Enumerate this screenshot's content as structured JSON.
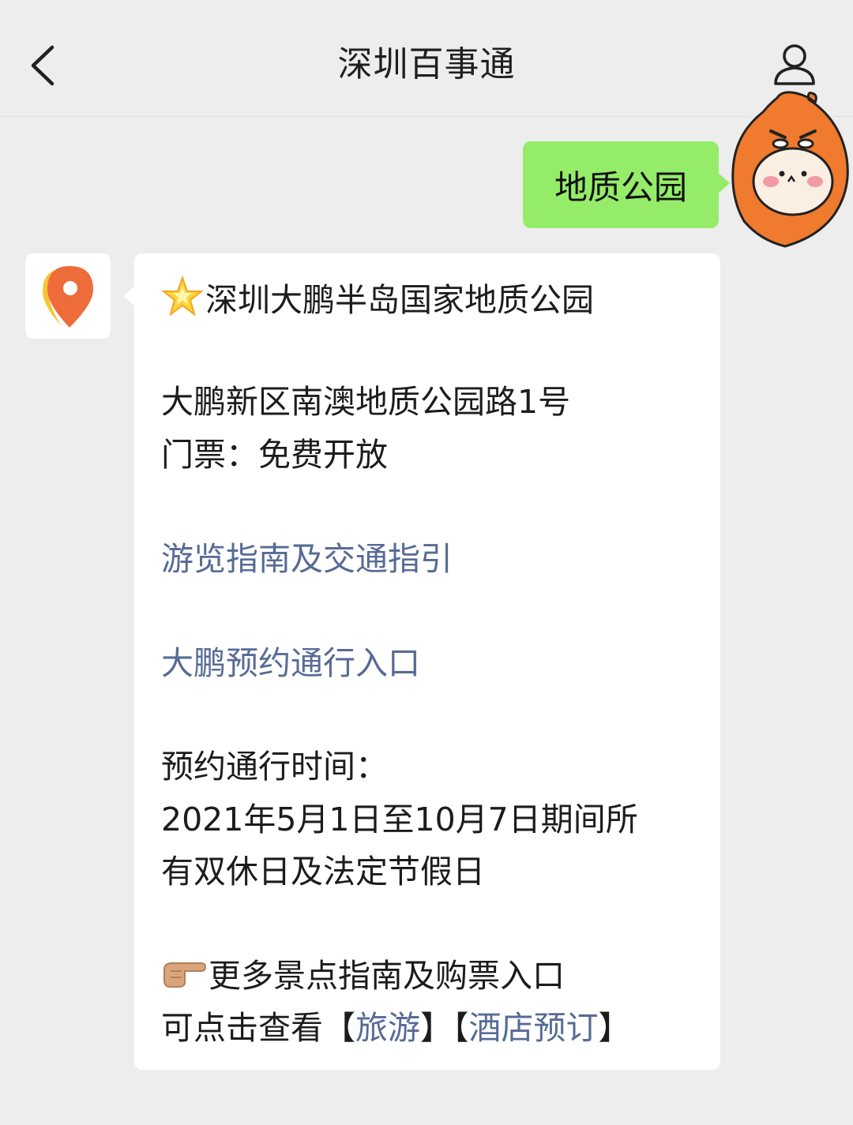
{
  "header": {
    "title": "深圳百事通",
    "back_icon": "chevron-left-icon",
    "profile_icon": "person-icon"
  },
  "messages": {
    "outgoing": {
      "text": "地质公园",
      "bubble_color": "#95ec69"
    },
    "incoming": {
      "park_name": "深圳大鹏半岛国家地质公园",
      "address": "大鹏新区南澳地质公园路1号",
      "ticket": "门票：免费开放",
      "guide_link": "游览指南及交通指引",
      "reservation_link": "大鹏预约通行入口",
      "reservation_time_label": "预约通行时间：",
      "reservation_time_line1": "2021年5月1日至10月7日期间所",
      "reservation_time_line2": "有双休日及法定节假日",
      "more_line": "更多景点指南及购票入口",
      "click_prefix": "可点击查看",
      "bracket_open_1": "【",
      "travel_link": "旅游",
      "bracket_close_1": "】",
      "bracket_open_2": "【",
      "hotel_link": "酒店预订",
      "bracket_close_2": "】"
    }
  },
  "colors": {
    "background": "#ededed",
    "link": "#576b95",
    "accent_orange": "#f07a2e"
  },
  "icons": {
    "star": "star-emoji-icon",
    "pointing": "pointing-hand-emoji-icon",
    "bot_avatar": "map-pin-icon",
    "self_avatar": "cartoon-avatar-icon"
  }
}
